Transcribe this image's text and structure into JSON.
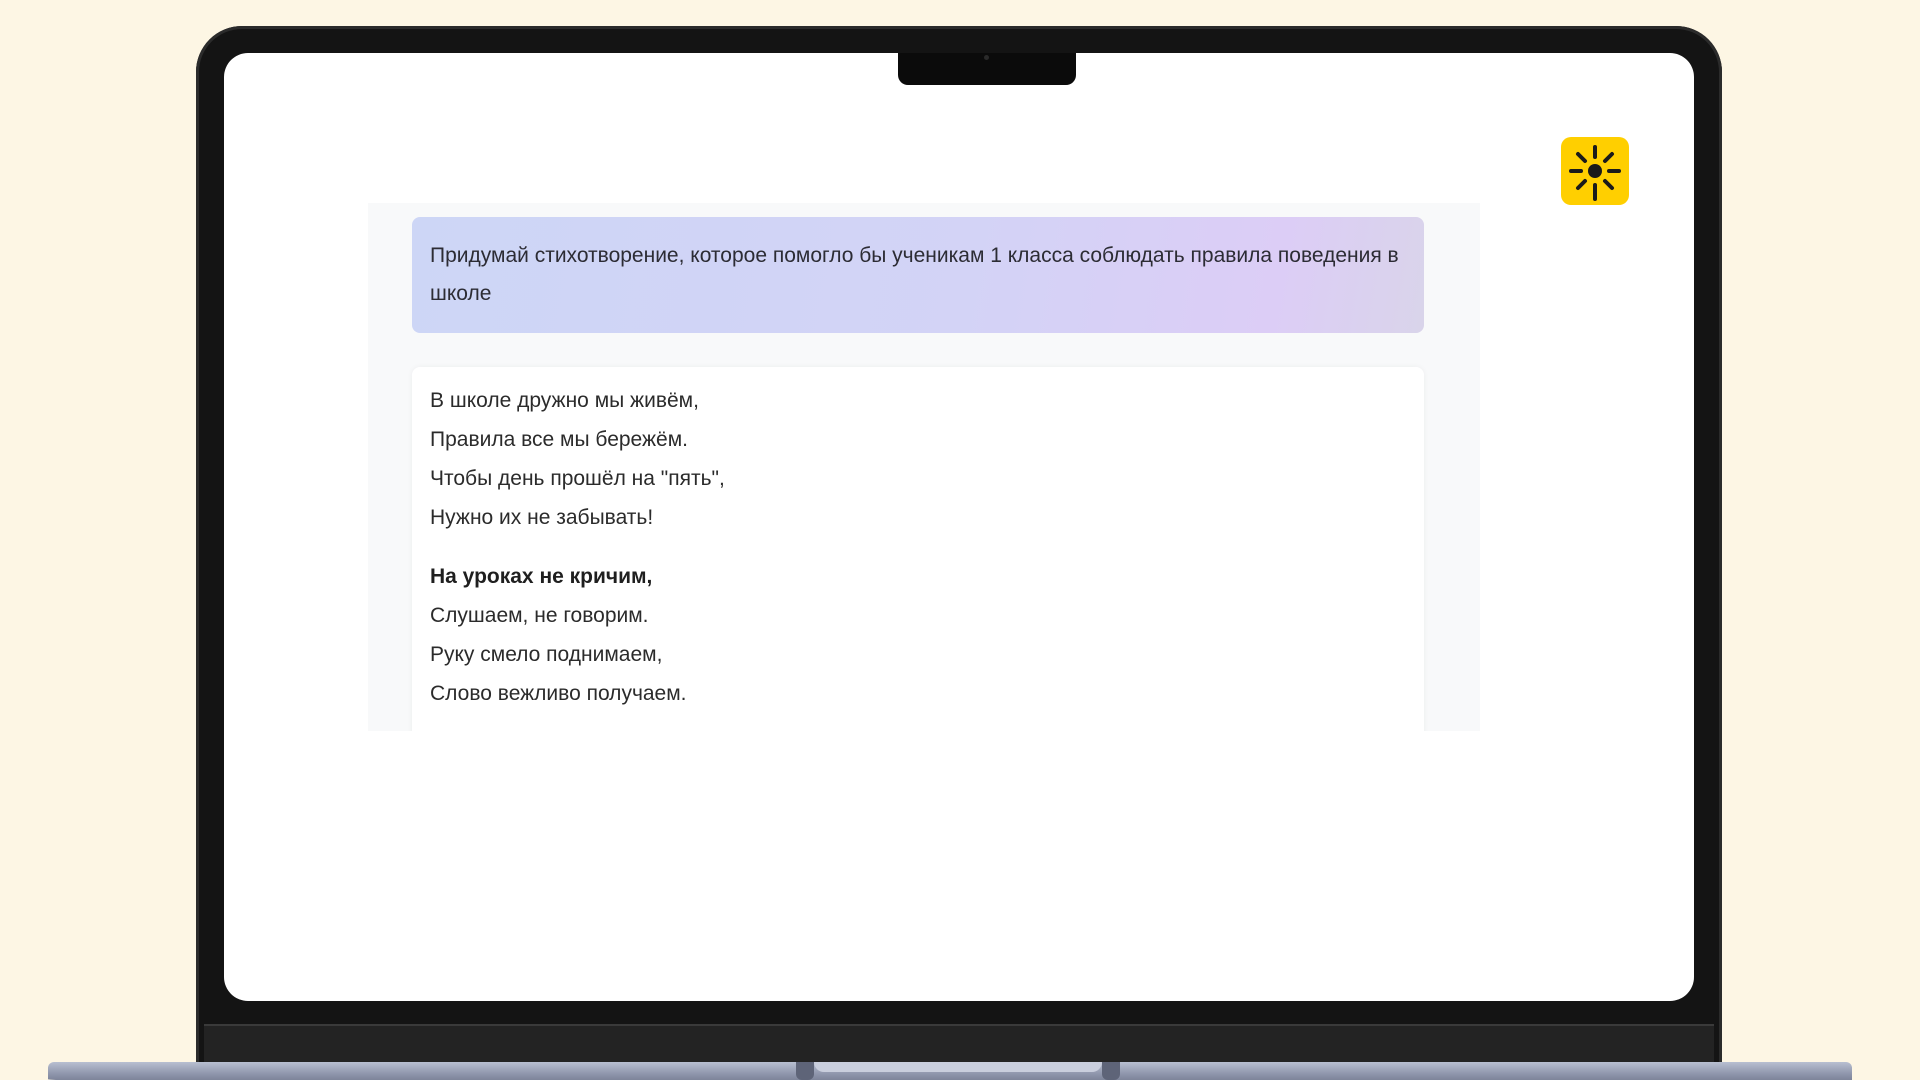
{
  "prompt": {
    "text": "Придумай стихотворение, которое помогло бы ученикам 1 класса соблюдать правила поведения в школе"
  },
  "answer": {
    "stanzas": [
      {
        "lines": [
          "В школе дружно мы живём,",
          "Правила все мы бережём.",
          "Чтобы день прошёл на \"пять\",",
          "Нужно их не забывать!"
        ]
      },
      {
        "lines": [
          "На уроках не кричим,",
          "Слушаем, не говорим.",
          "Руку смело поднимаем,",
          "Слово вежливо получаем."
        ]
      }
    ]
  },
  "logo": {
    "icon": "sun-icon",
    "color": "#ffcf00"
  },
  "colors": {
    "background": "#fdf6e4",
    "prompt_gradient_start": "#cdd6f6",
    "prompt_gradient_end": "#dccdf6",
    "card": "#ffffff"
  }
}
